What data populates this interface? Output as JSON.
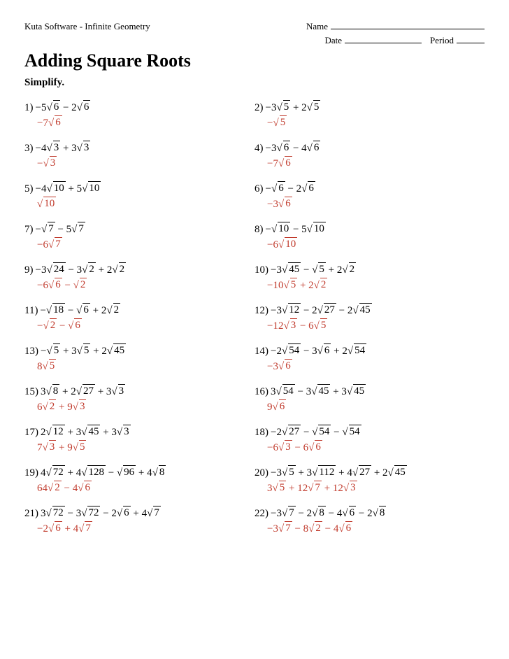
{
  "header": {
    "software": "Kuta Software - Infinite Geometry",
    "name_label": "Name",
    "date_label": "Date",
    "period_label": "Period"
  },
  "title": "Adding Square Roots",
  "instruction": "Simplify.",
  "problems": [
    {
      "num": "1)",
      "question": "−5√6 − 2√6",
      "answer": "−7√6",
      "q_html": "−5<span class='rad'><span class='rad-sign'>√</span><span class='rad-inner'>6</span></span> − 2<span class='rad'><span class='rad-sign'>√</span><span class='rad-inner'>6</span></span>",
      "a_html": "−7<span class='rad'><span class='rad-sign'>√</span><span class='rad-inner'>6</span></span>"
    },
    {
      "num": "2)",
      "question": "−3√5 + 2√5",
      "answer": "−√5",
      "q_html": "−3<span class='rad'><span class='rad-sign'>√</span><span class='rad-inner'>5</span></span> + 2<span class='rad'><span class='rad-sign'>√</span><span class='rad-inner'>5</span></span>",
      "a_html": "−<span class='rad'><span class='rad-sign'>√</span><span class='rad-inner'>5</span></span>"
    },
    {
      "num": "3)",
      "question": "−4√3 + 3√3",
      "answer": "−√3",
      "q_html": "−4<span class='rad'><span class='rad-sign'>√</span><span class='rad-inner'>3</span></span> + 3<span class='rad'><span class='rad-sign'>√</span><span class='rad-inner'>3</span></span>",
      "a_html": "−<span class='rad'><span class='rad-sign'>√</span><span class='rad-inner'>3</span></span>"
    },
    {
      "num": "4)",
      "question": "−3√6 − 4√6",
      "answer": "−7√6",
      "q_html": "−3<span class='rad'><span class='rad-sign'>√</span><span class='rad-inner'>6</span></span> − 4<span class='rad'><span class='rad-sign'>√</span><span class='rad-inner'>6</span></span>",
      "a_html": "−7<span class='rad'><span class='rad-sign'>√</span><span class='rad-inner'>6</span></span>"
    },
    {
      "num": "5)",
      "question": "−4√10 + 5√10",
      "answer": "√10",
      "q_html": "−4<span class='rad'><span class='rad-sign'>√</span><span class='rad-inner'>10</span></span> + 5<span class='rad'><span class='rad-sign'>√</span><span class='rad-inner'>10</span></span>",
      "a_html": "<span class='rad'><span class='rad-sign'>√</span><span class='rad-inner'>10</span></span>"
    },
    {
      "num": "6)",
      "question": "−√6 − 2√6",
      "answer": "−3√6",
      "q_html": "−<span class='rad'><span class='rad-sign'>√</span><span class='rad-inner'>6</span></span> − 2<span class='rad'><span class='rad-sign'>√</span><span class='rad-inner'>6</span></span>",
      "a_html": "−3<span class='rad'><span class='rad-sign'>√</span><span class='rad-inner'>6</span></span>"
    },
    {
      "num": "7)",
      "question": "−√7 − 5√7",
      "answer": "−6√7",
      "q_html": "−<span class='rad'><span class='rad-sign'>√</span><span class='rad-inner'>7</span></span> − 5<span class='rad'><span class='rad-sign'>√</span><span class='rad-inner'>7</span></span>",
      "a_html": "−6<span class='rad'><span class='rad-sign'>√</span><span class='rad-inner'>7</span></span>"
    },
    {
      "num": "8)",
      "question": "−√10 − 5√10",
      "answer": "−6√10",
      "q_html": "−<span class='rad'><span class='rad-sign'>√</span><span class='rad-inner'>10</span></span> − 5<span class='rad'><span class='rad-sign'>√</span><span class='rad-inner'>10</span></span>",
      "a_html": "−6<span class='rad'><span class='rad-sign'>√</span><span class='rad-inner'>10</span></span>"
    },
    {
      "num": "9)",
      "question": "−3√24 − 3√2 + 2√2",
      "answer": "−6√6 − √2",
      "q_html": "−3<span class='rad'><span class='rad-sign'>√</span><span class='rad-inner'>24</span></span> − 3<span class='rad'><span class='rad-sign'>√</span><span class='rad-inner'>2</span></span> + 2<span class='rad'><span class='rad-sign'>√</span><span class='rad-inner'>2</span></span>",
      "a_html": "−6<span class='rad'><span class='rad-sign'>√</span><span class='rad-inner'>6</span></span> − <span class='rad'><span class='rad-sign'>√</span><span class='rad-inner'>2</span></span>"
    },
    {
      "num": "10)",
      "question": "−3√45 − √5 + 2√2",
      "answer": "−10√5 + 2√2",
      "q_html": "−3<span class='rad'><span class='rad-sign'>√</span><span class='rad-inner'>45</span></span> − <span class='rad'><span class='rad-sign'>√</span><span class='rad-inner'>5</span></span> + 2<span class='rad'><span class='rad-sign'>√</span><span class='rad-inner'>2</span></span>",
      "a_html": "−10<span class='rad'><span class='rad-sign'>√</span><span class='rad-inner'>5</span></span> + 2<span class='rad'><span class='rad-sign'>√</span><span class='rad-inner'>2</span></span>"
    },
    {
      "num": "11)",
      "question": "−√18 − √6 + 2√2",
      "answer": "−√2 − √6",
      "q_html": "−<span class='rad'><span class='rad-sign'>√</span><span class='rad-inner'>18</span></span> − <span class='rad'><span class='rad-sign'>√</span><span class='rad-inner'>6</span></span> + 2<span class='rad'><span class='rad-sign'>√</span><span class='rad-inner'>2</span></span>",
      "a_html": "−<span class='rad'><span class='rad-sign'>√</span><span class='rad-inner'>2</span></span> − <span class='rad'><span class='rad-sign'>√</span><span class='rad-inner'>6</span></span>"
    },
    {
      "num": "12)",
      "question": "−3√12 − 2√27 − 2√45",
      "answer": "−12√3 − 6√5",
      "q_html": "−3<span class='rad'><span class='rad-sign'>√</span><span class='rad-inner'>12</span></span> − 2<span class='rad'><span class='rad-sign'>√</span><span class='rad-inner'>27</span></span> − 2<span class='rad'><span class='rad-sign'>√</span><span class='rad-inner'>45</span></span>",
      "a_html": "−12<span class='rad'><span class='rad-sign'>√</span><span class='rad-inner'>3</span></span> − 6<span class='rad'><span class='rad-sign'>√</span><span class='rad-inner'>5</span></span>"
    },
    {
      "num": "13)",
      "question": "−√5 + 3√5 + 2√45",
      "answer": "8√5",
      "q_html": "−<span class='rad'><span class='rad-sign'>√</span><span class='rad-inner'>5</span></span> + 3<span class='rad'><span class='rad-sign'>√</span><span class='rad-inner'>5</span></span> + 2<span class='rad'><span class='rad-sign'>√</span><span class='rad-inner'>45</span></span>",
      "a_html": "8<span class='rad'><span class='rad-sign'>√</span><span class='rad-inner'>5</span></span>"
    },
    {
      "num": "14)",
      "question": "−2√54 − 3√6 + 2√54",
      "answer": "−3√6",
      "q_html": "−2<span class='rad'><span class='rad-sign'>√</span><span class='rad-inner'>54</span></span> − 3<span class='rad'><span class='rad-sign'>√</span><span class='rad-inner'>6</span></span> + 2<span class='rad'><span class='rad-sign'>√</span><span class='rad-inner'>54</span></span>",
      "a_html": "−3<span class='rad'><span class='rad-sign'>√</span><span class='rad-inner'>6</span></span>"
    },
    {
      "num": "15)",
      "question": "3√8 + 2√27 + 3√3",
      "answer": "6√2 + 9√3",
      "q_html": "3<span class='rad'><span class='rad-sign'>√</span><span class='rad-inner'>8</span></span> + 2<span class='rad'><span class='rad-sign'>√</span><span class='rad-inner'>27</span></span> + 3<span class='rad'><span class='rad-sign'>√</span><span class='rad-inner'>3</span></span>",
      "a_html": "6<span class='rad'><span class='rad-sign'>√</span><span class='rad-inner'>2</span></span> + 9<span class='rad'><span class='rad-sign'>√</span><span class='rad-inner'>3</span></span>"
    },
    {
      "num": "16)",
      "question": "3√54 − 3√45 + 3√45",
      "answer": "9√6",
      "q_html": "3<span class='rad'><span class='rad-sign'>√</span><span class='rad-inner'>54</span></span> − 3<span class='rad'><span class='rad-sign'>√</span><span class='rad-inner'>45</span></span> + 3<span class='rad'><span class='rad-sign'>√</span><span class='rad-inner'>45</span></span>",
      "a_html": "9<span class='rad'><span class='rad-sign'>√</span><span class='rad-inner'>6</span></span>"
    },
    {
      "num": "17)",
      "question": "2√12 + 3√45 + 3√3",
      "answer": "7√3 + 9√5",
      "q_html": "2<span class='rad'><span class='rad-sign'>√</span><span class='rad-inner'>12</span></span> + 3<span class='rad'><span class='rad-sign'>√</span><span class='rad-inner'>45</span></span> + 3<span class='rad'><span class='rad-sign'>√</span><span class='rad-inner'>3</span></span>",
      "a_html": "7<span class='rad'><span class='rad-sign'>√</span><span class='rad-inner'>3</span></span> + 9<span class='rad'><span class='rad-sign'>√</span><span class='rad-inner'>5</span></span>"
    },
    {
      "num": "18)",
      "question": "−2√27 − √54 − √54",
      "answer": "−6√3 − 6√6",
      "q_html": "−2<span class='rad'><span class='rad-sign'>√</span><span class='rad-inner'>27</span></span> − <span class='rad'><span class='rad-sign'>√</span><span class='rad-inner'>54</span></span> − <span class='rad'><span class='rad-sign'>√</span><span class='rad-inner'>54</span></span>",
      "a_html": "−6<span class='rad'><span class='rad-sign'>√</span><span class='rad-inner'>3</span></span> − 6<span class='rad'><span class='rad-sign'>√</span><span class='rad-inner'>6</span></span>"
    },
    {
      "num": "19)",
      "question": "4√72 + 4√128 − √96 + 4√8",
      "answer": "64√2 − 4√6",
      "q_html": "4<span class='rad'><span class='rad-sign'>√</span><span class='rad-inner'>72</span></span> + 4<span class='rad'><span class='rad-sign'>√</span><span class='rad-inner'>128</span></span> − <span class='rad'><span class='rad-sign'>√</span><span class='rad-inner'>96</span></span> + 4<span class='rad'><span class='rad-sign'>√</span><span class='rad-inner'>8</span></span>",
      "a_html": "64<span class='rad'><span class='rad-sign'>√</span><span class='rad-inner'>2</span></span> − 4<span class='rad'><span class='rad-sign'>√</span><span class='rad-inner'>6</span></span>"
    },
    {
      "num": "20)",
      "question": "−3√5 + 3√112 + 4√27 + 2√45",
      "answer": "3√5 + 12√7 + 12√3",
      "q_html": "−3<span class='rad'><span class='rad-sign'>√</span><span class='rad-inner'>5</span></span> + 3<span class='rad'><span class='rad-sign'>√</span><span class='rad-inner'>112</span></span> + 4<span class='rad'><span class='rad-sign'>√</span><span class='rad-inner'>27</span></span> + 2<span class='rad'><span class='rad-sign'>√</span><span class='rad-inner'>45</span></span>",
      "a_html": "3<span class='rad'><span class='rad-sign'>√</span><span class='rad-inner'>5</span></span> + 12<span class='rad'><span class='rad-sign'>√</span><span class='rad-inner'>7</span></span> + 12<span class='rad'><span class='rad-sign'>√</span><span class='rad-inner'>3</span></span>"
    },
    {
      "num": "21)",
      "question": "3√72 − 3√72 − 2√6 + 4√7",
      "answer": "−2√6 + 4√7",
      "q_html": "3<span class='rad'><span class='rad-sign'>√</span><span class='rad-inner'>72</span></span> − 3<span class='rad'><span class='rad-sign'>√</span><span class='rad-inner'>72</span></span> − 2<span class='rad'><span class='rad-sign'>√</span><span class='rad-inner'>6</span></span> + 4<span class='rad'><span class='rad-sign'>√</span><span class='rad-inner'>7</span></span>",
      "a_html": "−2<span class='rad'><span class='rad-sign'>√</span><span class='rad-inner'>6</span></span> + 4<span class='rad'><span class='rad-sign'>√</span><span class='rad-inner'>7</span></span>"
    },
    {
      "num": "22)",
      "question": "−3√7 − 2√8 − 4√6 − 2√8",
      "answer": "−3√7 − 8√2 − 4√6",
      "q_html": "−3<span class='rad'><span class='rad-sign'>√</span><span class='rad-inner'>7</span></span> − 2<span class='rad'><span class='rad-sign'>√</span><span class='rad-inner'>8</span></span> − 4<span class='rad'><span class='rad-sign'>√</span><span class='rad-inner'>6</span></span> − 2<span class='rad'><span class='rad-sign'>√</span><span class='rad-inner'>8</span></span>",
      "a_html": "−3<span class='rad'><span class='rad-sign'>√</span><span class='rad-inner'>7</span></span> − 8<span class='rad'><span class='rad-sign'>√</span><span class='rad-inner'>2</span></span> − 4<span class='rad'><span class='rad-sign'>√</span><span class='rad-inner'>6</span></span>"
    }
  ]
}
